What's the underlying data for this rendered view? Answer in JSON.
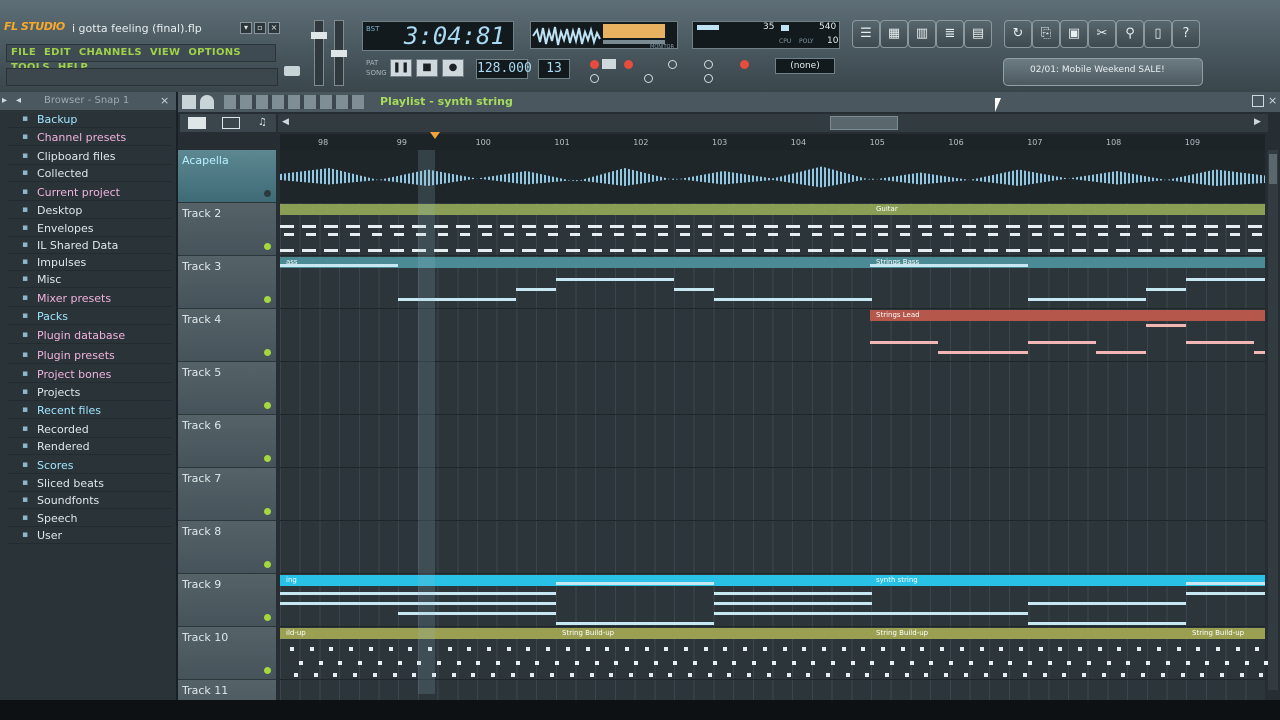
{
  "app": {
    "logo": "FL STUDIO",
    "filename": "i gotta feeling (final).flp"
  },
  "menu": [
    "FILE",
    "EDIT",
    "CHANNELS",
    "VIEW",
    "OPTIONS",
    "TOOLS",
    "HELP"
  ],
  "transport": {
    "time": "3:04:81",
    "time_sub": "BST",
    "tempo": "128.000",
    "pattern": "13",
    "mixer_preset": "(none)",
    "cpu_val": "35",
    "poly_val": "540",
    "poly_sub": "10",
    "cpu_label": "CPU",
    "poly_label": "POLY",
    "monitor_label": "MONITOR"
  },
  "news": "02/01: Mobile Weekend SALE!",
  "browser": {
    "title": "Browser - Snap 1",
    "items": [
      {
        "label": "Backup",
        "icon": "folder-icon",
        "style": "hl"
      },
      {
        "label": "Channel presets",
        "icon": "folder-icon",
        "style": "pk"
      },
      {
        "label": "Clipboard files",
        "icon": "folder-icon",
        "style": ""
      },
      {
        "label": "Collected",
        "icon": "folder-icon",
        "style": ""
      },
      {
        "label": "Current project",
        "icon": "folder-icon",
        "style": "pk"
      },
      {
        "label": "Desktop",
        "icon": "folder-icon",
        "style": ""
      },
      {
        "label": "Envelopes",
        "icon": "folder-icon",
        "style": ""
      },
      {
        "label": "IL Shared Data",
        "icon": "folder-icon",
        "style": ""
      },
      {
        "label": "Impulses",
        "icon": "folder-icon",
        "style": ""
      },
      {
        "label": "Misc",
        "icon": "folder-icon",
        "style": ""
      },
      {
        "label": "Mixer presets",
        "icon": "folder-icon",
        "style": "pk"
      },
      {
        "label": "Packs",
        "icon": "folder-icon",
        "style": "hl"
      },
      {
        "label": "Plugin database",
        "icon": "folder-icon",
        "style": "pk"
      },
      {
        "label": "Plugin presets",
        "icon": "folder-icon",
        "style": "pk"
      },
      {
        "label": "Project bones",
        "icon": "folder-icon",
        "style": "pk"
      },
      {
        "label": "Projects",
        "icon": "folder-icon",
        "style": ""
      },
      {
        "label": "Recent files",
        "icon": "folder-icon",
        "style": "hl"
      },
      {
        "label": "Recorded",
        "icon": "folder-icon",
        "style": ""
      },
      {
        "label": "Rendered",
        "icon": "folder-icon",
        "style": ""
      },
      {
        "label": "Scores",
        "icon": "folder-icon",
        "style": "hl"
      },
      {
        "label": "Sliced beats",
        "icon": "folder-icon",
        "style": ""
      },
      {
        "label": "Soundfonts",
        "icon": "folder-icon",
        "style": ""
      },
      {
        "label": "Speech",
        "icon": "folder-icon",
        "style": ""
      },
      {
        "label": "User",
        "icon": "folder-icon",
        "style": ""
      }
    ]
  },
  "playlist": {
    "title": "Playlist - synth string",
    "ruler": [
      "98",
      "99",
      "100",
      "101",
      "102",
      "103",
      "104",
      "105",
      "106",
      "107",
      "108",
      "109"
    ],
    "tracks": [
      {
        "name": "Acapella",
        "selected": true
      },
      {
        "name": "Track 2"
      },
      {
        "name": "Track 3"
      },
      {
        "name": "Track 4"
      },
      {
        "name": "Track 5"
      },
      {
        "name": "Track 6"
      },
      {
        "name": "Track 7"
      },
      {
        "name": "Track 8"
      },
      {
        "name": "Track 9"
      },
      {
        "name": "Track 10"
      },
      {
        "name": "Track 11"
      }
    ],
    "clips": {
      "guitar": "Guitar",
      "strings_bass_a": "ass",
      "strings_bass_b": "Strings Bass",
      "strings_lead": "Strings Lead",
      "synth_a": "ing",
      "synth_b": "synth string",
      "buildup_a": "ild-up",
      "buildup_b": "String Build-up",
      "buildup_c": "String Build-up",
      "buildup_d": "String Build-up"
    }
  },
  "colors": {
    "accent": "#a6db5c",
    "clip_green": "#8fa35b",
    "clip_teal": "#4a8b95",
    "clip_red": "#b5574b",
    "clip_cyan": "#29c1e6",
    "clip_olive": "#9b9f51"
  }
}
